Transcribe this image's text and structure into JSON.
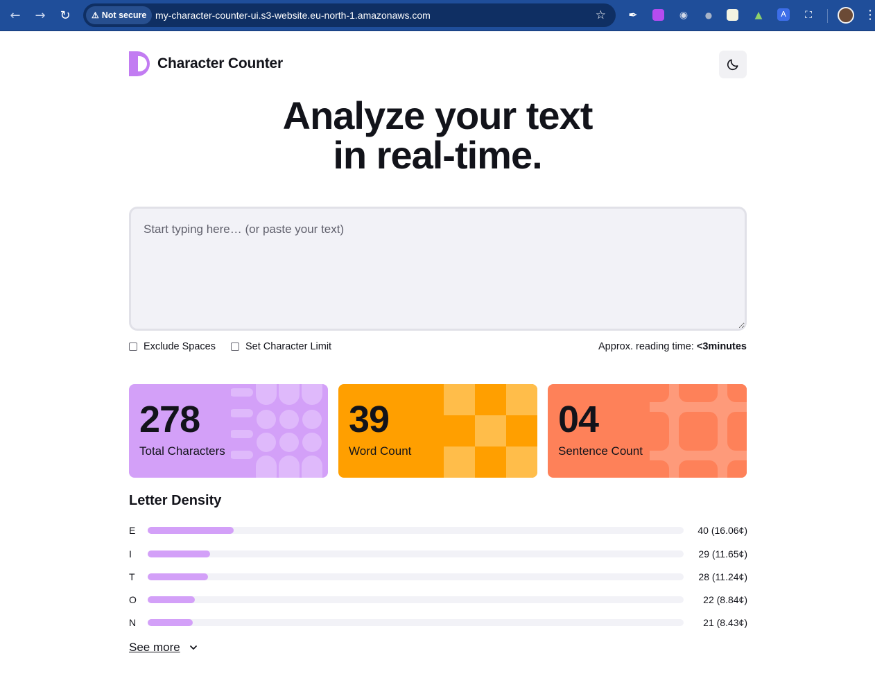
{
  "browser": {
    "security_label": "Not secure",
    "url": "my-character-counter-ui.s3-website.eu-north-1.amazonaws.com",
    "icons": [
      "back-icon",
      "forward-icon",
      "reload-icon",
      "warning-icon",
      "star-icon",
      "eyedropper-icon",
      "extension-icon",
      "camera-icon",
      "extensions-puzzle-icon",
      "profile-avatar",
      "menu-icon"
    ]
  },
  "header": {
    "app_name": "Character Counter",
    "theme_icon": "moon-icon"
  },
  "hero": {
    "line1": "Analyze your text",
    "line2": "in real-time."
  },
  "editor": {
    "placeholder": "Start typing here… (or paste your text)",
    "value": ""
  },
  "options": {
    "exclude_spaces": "Exclude Spaces",
    "char_limit": "Set Character Limit",
    "reading_label": "Approx. reading time:",
    "reading_value": "<3minutes"
  },
  "stats": [
    {
      "value": "278",
      "label": "Total Characters",
      "color": "#d3a0f8"
    },
    {
      "value": "39",
      "label": "Word Count",
      "color": "#ff9f00"
    },
    {
      "value": "04",
      "label": "Sentence Count",
      "color": "#fe8159"
    }
  ],
  "density": {
    "title": "Letter Density",
    "rows": [
      {
        "letter": "E",
        "label": "40 (16.06¢)",
        "percent": 16.06
      },
      {
        "letter": "I",
        "label": "29 (11.65¢)",
        "percent": 11.65
      },
      {
        "letter": "T",
        "label": "28 (11.24¢)",
        "percent": 11.24
      },
      {
        "letter": "O",
        "label": "22 (8.84¢)",
        "percent": 8.84
      },
      {
        "letter": "N",
        "label": "21 (8.43¢)",
        "percent": 8.43
      }
    ],
    "see_more": "See more"
  }
}
